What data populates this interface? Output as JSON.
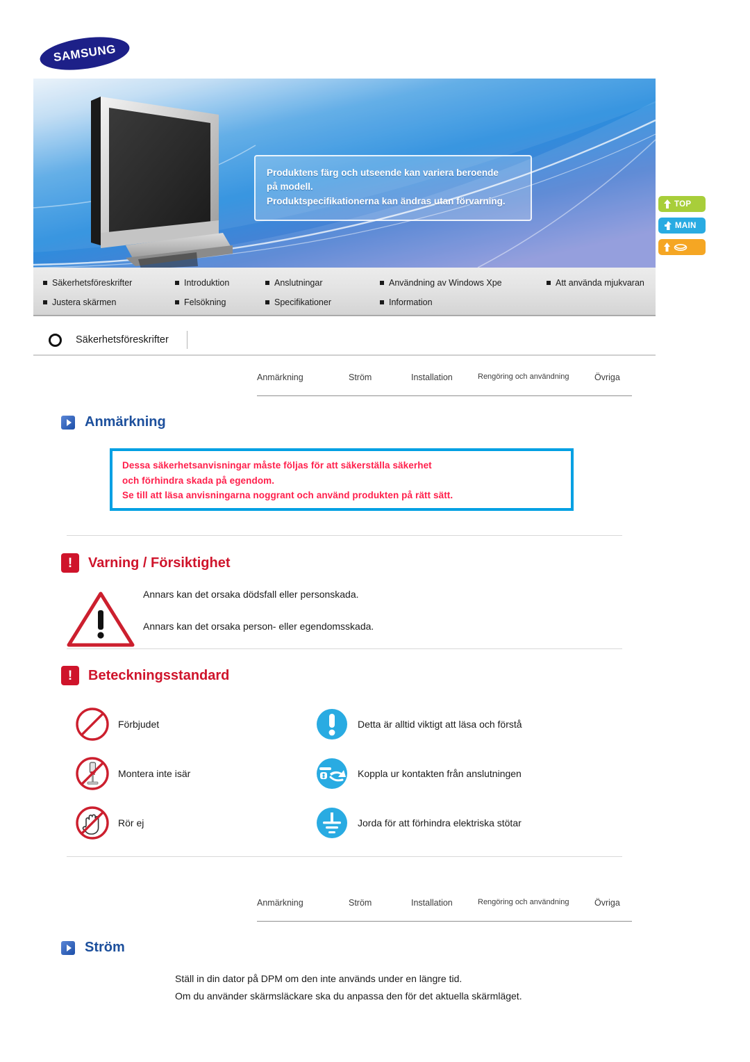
{
  "brand": {
    "logo_text": "SAMSUNG"
  },
  "banner": {
    "callout_lines": [
      "Produktens färg och utseende kan variera beroende",
      "på modell.",
      "Produktspecifikationerna kan ändras utan förvarning."
    ]
  },
  "side_buttons": [
    {
      "name": "top",
      "label": "TOP",
      "icon": "arrow-up-icon",
      "color": "#a8ce3a"
    },
    {
      "name": "main",
      "label": "MAIN",
      "icon": "arrow-turn-up-icon",
      "color": "#29abe2"
    },
    {
      "name": "prev",
      "label": "",
      "icon": "arrow-up-link-icon",
      "color": "#f5a623"
    }
  ],
  "main_nav": {
    "row1": [
      "Säkerhetsföreskrifter",
      "Introduktion",
      "Anslutningar",
      "Användning av Windows Xpe",
      "Att använda mjukvaran"
    ],
    "row2": [
      "Justera skärmen",
      "Felsökning",
      "Specifikationer",
      "Information"
    ]
  },
  "breadcrumb": {
    "icon": "ring-icon",
    "label": "Säkerhetsföreskrifter"
  },
  "sub_tabs": [
    "Anmärkning",
    "Ström",
    "Installation",
    "Rengöring och användning",
    "Övriga"
  ],
  "sections": {
    "anmarkning": {
      "heading": "Anmärkning",
      "notice_lines": [
        "Dessa säkerhetsanvisningar måste följas för att säkerställa säkerhet",
        "och förhindra skada på egendom.",
        "Se till att läsa anvisningarna noggrant och använd produkten på rätt sätt."
      ]
    },
    "varning": {
      "heading": "Varning / Försiktighet",
      "icon": "exclamation-box-icon",
      "lines": [
        "Annars kan det orsaka dödsfall eller personskada.",
        "Annars kan det orsaka person- eller egendomsskada."
      ]
    },
    "beteckningsstandard": {
      "heading": "Beteckningsstandard",
      "icon": "exclamation-box-icon",
      "rows": [
        {
          "left_icon": "prohibited-icon",
          "left_label": "Förbjudet",
          "right_icon": "important-exclamation-icon",
          "right_label": "Detta är alltid viktigt att läsa och förstå"
        },
        {
          "left_icon": "no-disassembly-icon",
          "left_label": "Montera inte isär",
          "right_icon": "unplug-icon",
          "right_label": "Koppla ur kontakten från anslutningen"
        },
        {
          "left_icon": "do-not-touch-icon",
          "left_label": "Rör ej",
          "right_icon": "ground-icon",
          "right_label": "Jorda för att förhindra elektriska stötar"
        }
      ]
    },
    "strom": {
      "heading": "Ström",
      "lines": [
        "Ställ in din dator på DPM om den inte används under en längre tid.",
        "Om du använder skärmsläckare ska du anpassa den för det aktuella skärmläget."
      ]
    }
  },
  "colors": {
    "brand_blue": "#1d2088",
    "heading_blue": "#1c4f9c",
    "heading_red": "#cf142b",
    "notice_border": "#00a0e3",
    "notice_text": "#ff1f4b",
    "mandatory_blue": "#29abe2",
    "prohibition_red": "#cc1f2e"
  }
}
